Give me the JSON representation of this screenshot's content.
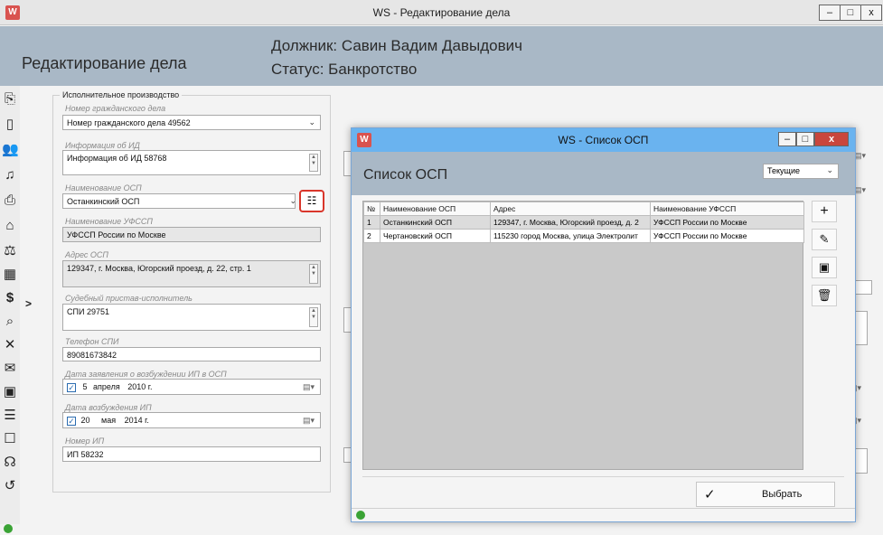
{
  "window": {
    "title": "WS - Редактирование дела",
    "minimize": "–",
    "maximize": "□",
    "close": "x",
    "app_icon": "W"
  },
  "header": {
    "left_title": "Редактирование дела",
    "debtor": "Должник: Савин Вадим Давыдович",
    "status": "Статус: Банкротство"
  },
  "sidebar": {
    "icons": [
      "import-doc-icon",
      "document-icon",
      "users-icon",
      "bell-icon",
      "doc-sync-icon",
      "building-icon",
      "auction-icon",
      "calendar-icon",
      "dollar-icon",
      "house-search-icon",
      "phone-off-icon",
      "envelope-icon",
      "doc-check-icon",
      "doc-lines-icon",
      "chat-icon",
      "group-talk-icon",
      "history-icon"
    ],
    "expand": ">"
  },
  "form": {
    "section_title": "Исполнительное производство",
    "civil_case": {
      "label": "Номер гражданского дела",
      "value": "Номер гражданского дела 49562"
    },
    "id_info": {
      "label": "Информация об ИД",
      "value": "Информация об ИД 58768"
    },
    "osp_name": {
      "label": "Наименование ОСП",
      "value": "Останкинский ОСП"
    },
    "ufssp_name": {
      "label": "Наименование УФССП",
      "value": "УФССП России по Москве"
    },
    "osp_address": {
      "label": "Адрес ОСП",
      "value": "129347, г. Москва, Югорский проезд, д. 22, стр. 1"
    },
    "bailiff": {
      "label": "Судебный пристав-исполнитель",
      "value": "СПИ 29751"
    },
    "spi_phone": {
      "label": "Телефон СПИ",
      "value": "89081673842"
    },
    "claim_date": {
      "label": "Дата заявления о возбуждении ИП в ОСП",
      "day": "5",
      "month": "апреля",
      "year": "2010 г."
    },
    "start_date": {
      "label": "Дата возбуждения ИП",
      "day": "20",
      "month": "мая",
      "year": "2014 г."
    },
    "ip_number": {
      "label": "Номер ИП",
      "value": "ИП 58232"
    }
  },
  "dialog": {
    "title": "WS - Список ОСП",
    "heading": "Список ОСП",
    "filter_value": "Текущие",
    "columns": [
      "№",
      "Наименование ОСП",
      "Адрес",
      "Наименование УФССП"
    ],
    "rows": [
      [
        "1",
        "Останкинский ОСП",
        "129347, г. Москва, Югорский проезд, д. 2",
        "УФССП России по Москве"
      ],
      [
        "2",
        "Чертановский ОСП",
        "115230 город Москва, улица Электролит",
        "УФССП России по Москве"
      ]
    ],
    "select_label": "Выбрать",
    "check_glyph": "✓"
  }
}
